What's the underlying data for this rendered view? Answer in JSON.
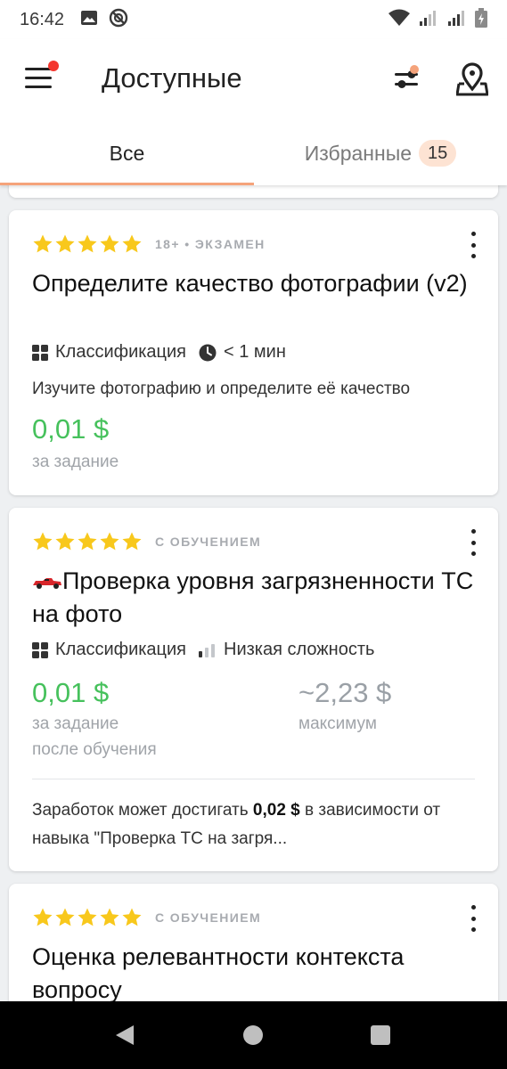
{
  "status_bar": {
    "time": "16:42"
  },
  "header": {
    "title": "Доступные"
  },
  "tabs": {
    "all": "Все",
    "favorites": "Избранные",
    "favorites_count": "15"
  },
  "colors": {
    "accent": "#f5a37b",
    "price": "#46c15c",
    "star": "#f8c81c",
    "badge_bg": "#fde3d3",
    "notify_dot": "#f4372f"
  },
  "cards": [
    {
      "rating": 5,
      "meta": "18+ • ЭКЗАМЕН",
      "title": "Определите качество фотографии (v2)",
      "type": "Классификация",
      "duration": "< 1 мин",
      "description": "Изучите фотографию и определите её качество",
      "price": "0,01 $",
      "price_caption": "за задание"
    },
    {
      "rating": 5,
      "meta": "С ОБУЧЕНИЕМ",
      "title": "Проверка уровня загрязненности ТС на фото",
      "type": "Классификация",
      "difficulty": "Низкая сложность",
      "price": "0,01 $",
      "price_caption_1": "за задание",
      "price_caption_2": "после обучения",
      "max_price": "~2,23 $",
      "max_caption": "максимум",
      "earn_text_1": "Заработок может достигать ",
      "earn_amount": "0,02 $",
      "earn_text_2": " в зависимости от навыка \"Проверка ТС на загря..."
    },
    {
      "rating": 5,
      "meta": "С ОБУЧЕНИЕМ",
      "title": "Оценка релевантности контекста вопросу"
    }
  ],
  "icons": {
    "menu": "hamburger-menu-icon",
    "filter": "sliders-filter-icon",
    "map": "map-pin-icon",
    "type": "grid-squares-icon",
    "duration": "clock-icon",
    "difficulty": "signal-bars-icon",
    "race_car": "race-car-icon"
  }
}
